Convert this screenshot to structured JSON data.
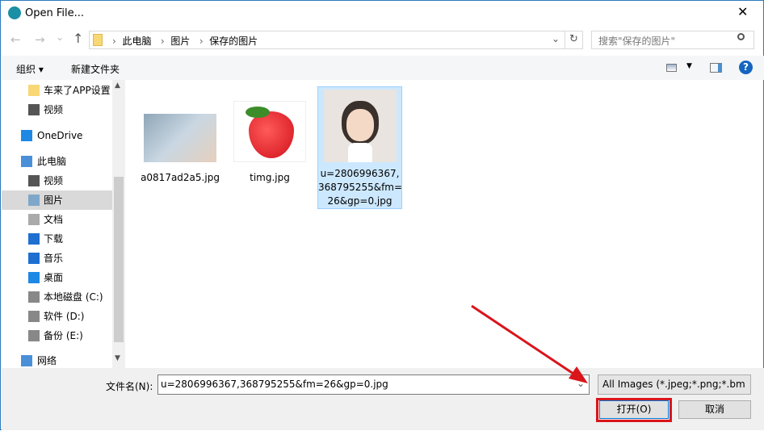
{
  "window": {
    "title": "Open File...",
    "close": "✕"
  },
  "nav": {
    "back": "←",
    "forward": "→",
    "recent": "⌄",
    "up": "↑",
    "breadcrumb": [
      "此电脑",
      "图片",
      "保存的图片"
    ],
    "refresh": "↻",
    "dropdown": "⌄"
  },
  "search": {
    "placeholder": "搜索\"保存的图片\""
  },
  "toolbar": {
    "organize": "组织 ▾",
    "new_folder": "新建文件夹",
    "help": "?"
  },
  "sidebar": {
    "items": [
      {
        "label": "车来了APP设置",
        "icon": "folder-icon"
      },
      {
        "label": "视频",
        "icon": "video-icon"
      },
      {
        "label": "OneDrive",
        "icon": "cloud-icon"
      },
      {
        "label": "此电脑",
        "icon": "computer-icon"
      },
      {
        "label": "视频",
        "icon": "video-icon"
      },
      {
        "label": "图片",
        "icon": "pictures-icon",
        "selected": true
      },
      {
        "label": "文档",
        "icon": "document-icon"
      },
      {
        "label": "下载",
        "icon": "download-icon"
      },
      {
        "label": "音乐",
        "icon": "music-icon"
      },
      {
        "label": "桌面",
        "icon": "desktop-icon"
      },
      {
        "label": "本地磁盘 (C:)",
        "icon": "drive-icon"
      },
      {
        "label": "软件 (D:)",
        "icon": "drive-icon"
      },
      {
        "label": "备份 (E:)",
        "icon": "drive-icon"
      },
      {
        "label": "网络",
        "icon": "network-icon"
      }
    ]
  },
  "files": [
    {
      "name": "a0817ad2a5.jpg"
    },
    {
      "name": "timg.jpg"
    },
    {
      "name": "u=2806996367,368795255&fm=26&gp=0.jpg",
      "display": [
        "u=2806996367,",
        "368795255&fm=",
        "26&gp=0.jpg"
      ],
      "selected": true
    }
  ],
  "footer": {
    "filename_label": "文件名(N):",
    "filename_value": "u=2806996367,368795255&fm=26&gp=0.jpg",
    "filter": "All Images (*.jpeg;*.png;*.bm",
    "open": "打开(O)",
    "cancel": "取消"
  },
  "colors": {
    "accent": "#2b7bbd",
    "highlight": "#cce8ff",
    "annotation": "#d9151b"
  }
}
